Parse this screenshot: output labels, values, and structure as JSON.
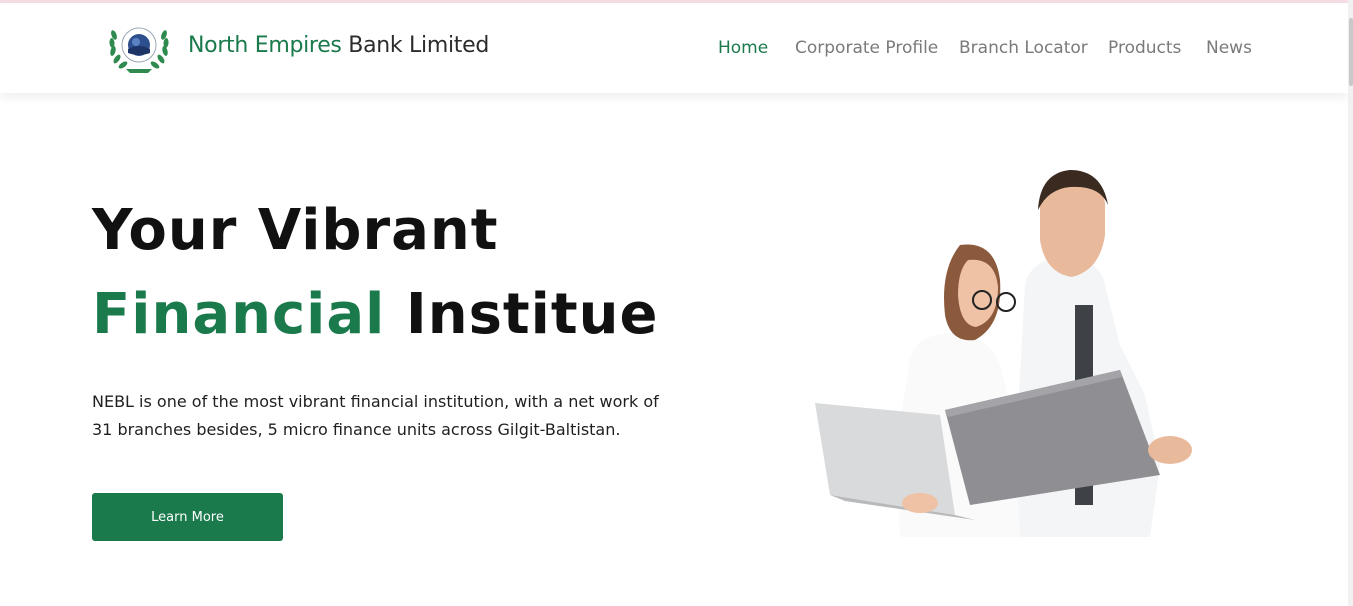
{
  "header": {
    "brand_primary": "North Empires",
    "brand_secondary": "Bank Limited",
    "nav": [
      {
        "label": "Home",
        "active": true
      },
      {
        "label": "Corporate Profile",
        "active": false
      },
      {
        "label": "Branch Locator",
        "active": false
      },
      {
        "label": "Products",
        "active": false
      },
      {
        "label": "News",
        "active": false
      }
    ]
  },
  "hero": {
    "title_line1": "Your Vibrant",
    "title_line2_accent": "Financial",
    "title_line2_rest": "Institue",
    "description": "NEBL is one of the most vibrant financial institution, with a net work of 31 branches besides, 5 micro finance units across Gilgit-Baltistan.",
    "cta_label": "Learn More",
    "image": "two-people-with-laptops"
  },
  "colors": {
    "brand_green": "#1a7a4c",
    "text_dark": "#111111",
    "nav_gray": "#7a7a7a"
  }
}
